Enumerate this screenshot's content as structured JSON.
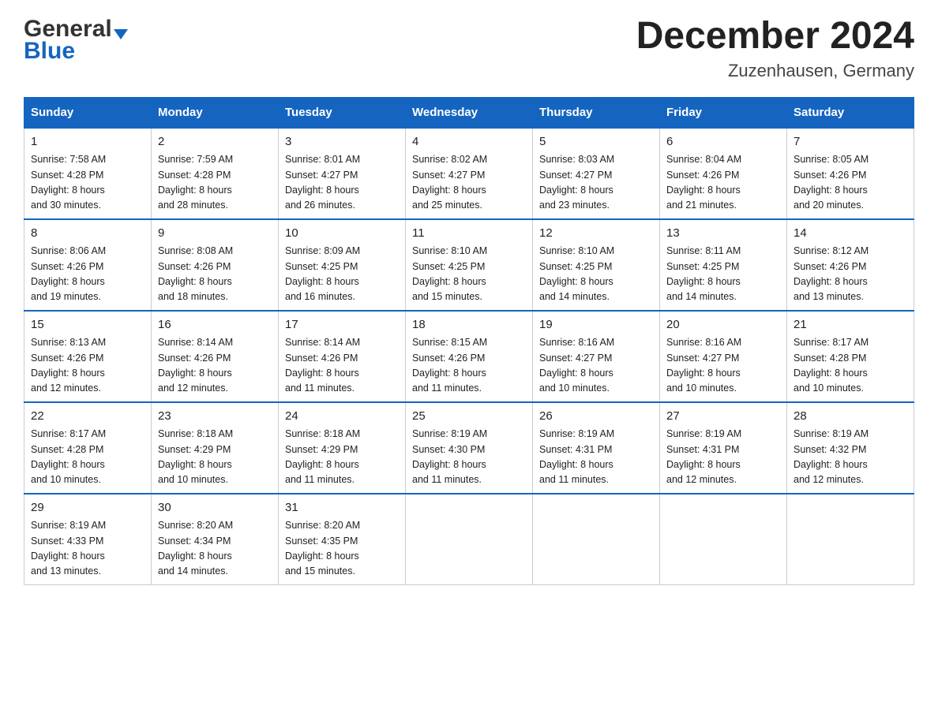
{
  "logo": {
    "general": "General",
    "blue": "Blue"
  },
  "header": {
    "month": "December 2024",
    "location": "Zuzenhausen, Germany"
  },
  "weekdays": [
    "Sunday",
    "Monday",
    "Tuesday",
    "Wednesday",
    "Thursday",
    "Friday",
    "Saturday"
  ],
  "weeks": [
    [
      {
        "day": "1",
        "sunrise": "7:58 AM",
        "sunset": "4:28 PM",
        "daylight": "8 hours and 30 minutes."
      },
      {
        "day": "2",
        "sunrise": "7:59 AM",
        "sunset": "4:28 PM",
        "daylight": "8 hours and 28 minutes."
      },
      {
        "day": "3",
        "sunrise": "8:01 AM",
        "sunset": "4:27 PM",
        "daylight": "8 hours and 26 minutes."
      },
      {
        "day": "4",
        "sunrise": "8:02 AM",
        "sunset": "4:27 PM",
        "daylight": "8 hours and 25 minutes."
      },
      {
        "day": "5",
        "sunrise": "8:03 AM",
        "sunset": "4:27 PM",
        "daylight": "8 hours and 23 minutes."
      },
      {
        "day": "6",
        "sunrise": "8:04 AM",
        "sunset": "4:26 PM",
        "daylight": "8 hours and 21 minutes."
      },
      {
        "day": "7",
        "sunrise": "8:05 AM",
        "sunset": "4:26 PM",
        "daylight": "8 hours and 20 minutes."
      }
    ],
    [
      {
        "day": "8",
        "sunrise": "8:06 AM",
        "sunset": "4:26 PM",
        "daylight": "8 hours and 19 minutes."
      },
      {
        "day": "9",
        "sunrise": "8:08 AM",
        "sunset": "4:26 PM",
        "daylight": "8 hours and 18 minutes."
      },
      {
        "day": "10",
        "sunrise": "8:09 AM",
        "sunset": "4:25 PM",
        "daylight": "8 hours and 16 minutes."
      },
      {
        "day": "11",
        "sunrise": "8:10 AM",
        "sunset": "4:25 PM",
        "daylight": "8 hours and 15 minutes."
      },
      {
        "day": "12",
        "sunrise": "8:10 AM",
        "sunset": "4:25 PM",
        "daylight": "8 hours and 14 minutes."
      },
      {
        "day": "13",
        "sunrise": "8:11 AM",
        "sunset": "4:25 PM",
        "daylight": "8 hours and 14 minutes."
      },
      {
        "day": "14",
        "sunrise": "8:12 AM",
        "sunset": "4:26 PM",
        "daylight": "8 hours and 13 minutes."
      }
    ],
    [
      {
        "day": "15",
        "sunrise": "8:13 AM",
        "sunset": "4:26 PM",
        "daylight": "8 hours and 12 minutes."
      },
      {
        "day": "16",
        "sunrise": "8:14 AM",
        "sunset": "4:26 PM",
        "daylight": "8 hours and 12 minutes."
      },
      {
        "day": "17",
        "sunrise": "8:14 AM",
        "sunset": "4:26 PM",
        "daylight": "8 hours and 11 minutes."
      },
      {
        "day": "18",
        "sunrise": "8:15 AM",
        "sunset": "4:26 PM",
        "daylight": "8 hours and 11 minutes."
      },
      {
        "day": "19",
        "sunrise": "8:16 AM",
        "sunset": "4:27 PM",
        "daylight": "8 hours and 10 minutes."
      },
      {
        "day": "20",
        "sunrise": "8:16 AM",
        "sunset": "4:27 PM",
        "daylight": "8 hours and 10 minutes."
      },
      {
        "day": "21",
        "sunrise": "8:17 AM",
        "sunset": "4:28 PM",
        "daylight": "8 hours and 10 minutes."
      }
    ],
    [
      {
        "day": "22",
        "sunrise": "8:17 AM",
        "sunset": "4:28 PM",
        "daylight": "8 hours and 10 minutes."
      },
      {
        "day": "23",
        "sunrise": "8:18 AM",
        "sunset": "4:29 PM",
        "daylight": "8 hours and 10 minutes."
      },
      {
        "day": "24",
        "sunrise": "8:18 AM",
        "sunset": "4:29 PM",
        "daylight": "8 hours and 11 minutes."
      },
      {
        "day": "25",
        "sunrise": "8:19 AM",
        "sunset": "4:30 PM",
        "daylight": "8 hours and 11 minutes."
      },
      {
        "day": "26",
        "sunrise": "8:19 AM",
        "sunset": "4:31 PM",
        "daylight": "8 hours and 11 minutes."
      },
      {
        "day": "27",
        "sunrise": "8:19 AM",
        "sunset": "4:31 PM",
        "daylight": "8 hours and 12 minutes."
      },
      {
        "day": "28",
        "sunrise": "8:19 AM",
        "sunset": "4:32 PM",
        "daylight": "8 hours and 12 minutes."
      }
    ],
    [
      {
        "day": "29",
        "sunrise": "8:19 AM",
        "sunset": "4:33 PM",
        "daylight": "8 hours and 13 minutes."
      },
      {
        "day": "30",
        "sunrise": "8:20 AM",
        "sunset": "4:34 PM",
        "daylight": "8 hours and 14 minutes."
      },
      {
        "day": "31",
        "sunrise": "8:20 AM",
        "sunset": "4:35 PM",
        "daylight": "8 hours and 15 minutes."
      },
      null,
      null,
      null,
      null
    ]
  ],
  "labels": {
    "sunrise": "Sunrise:",
    "sunset": "Sunset:",
    "daylight": "Daylight:"
  }
}
